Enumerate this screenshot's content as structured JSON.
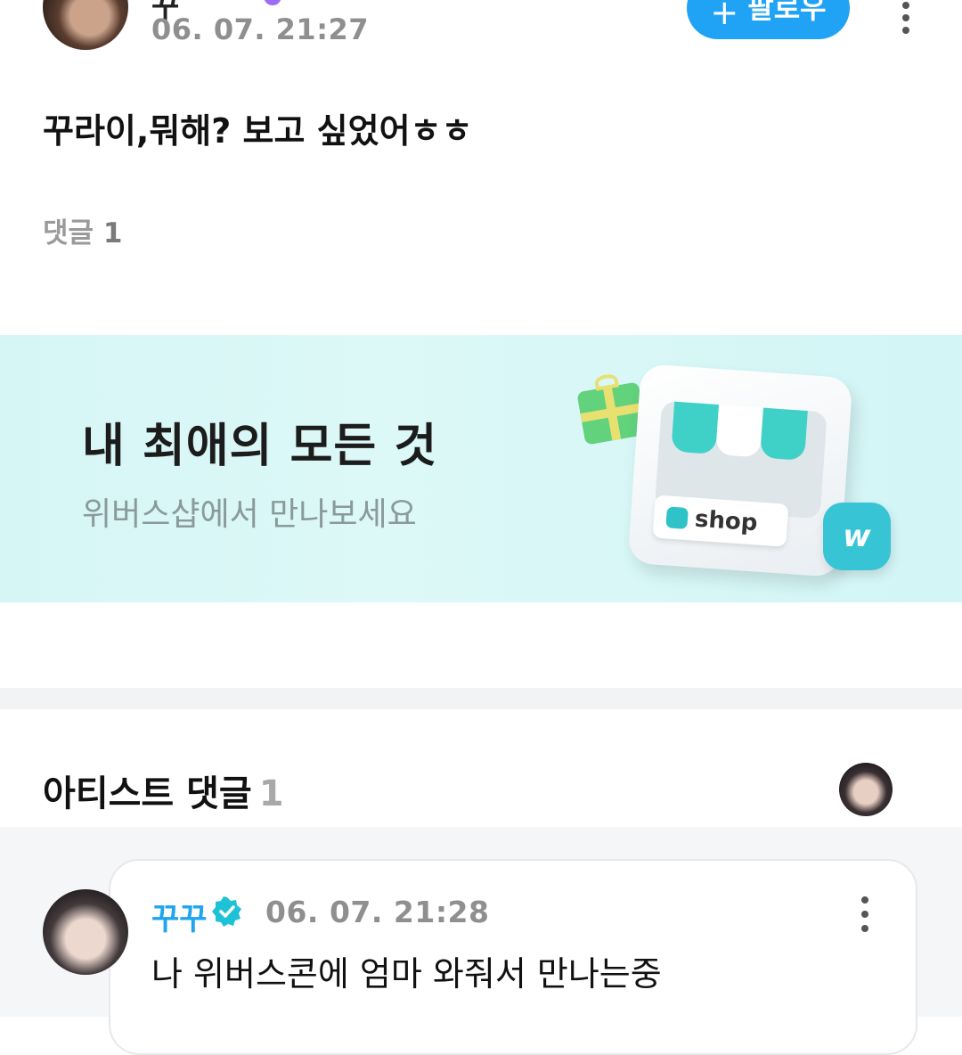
{
  "post": {
    "author_name_partial": "꾸",
    "time": "06. 07. 21:27",
    "follow_label": "팔로우",
    "follow_icon": "+",
    "body": "꾸라이,뭐해? 보고 싶었어ㅎㅎ",
    "comment_label": "댓글",
    "comment_count": "1"
  },
  "banner": {
    "title": "내 최애의 모든 것",
    "subtitle": "위버스샵에서 만나보세요",
    "sign_text": "shop",
    "bag_letter": "w"
  },
  "artist_comments": {
    "title": "아티스트 댓글",
    "count": "1",
    "comment": {
      "name": "꾸꾸",
      "time": "06. 07. 21:28",
      "text": "나 위버스콘에 엄마 와줘서 만나는중"
    }
  },
  "colors": {
    "accent": "#21a3f5",
    "artist_name": "#1ea5ee",
    "verified": "#1ec2d6",
    "banner_bg": "#d6f6f6"
  }
}
